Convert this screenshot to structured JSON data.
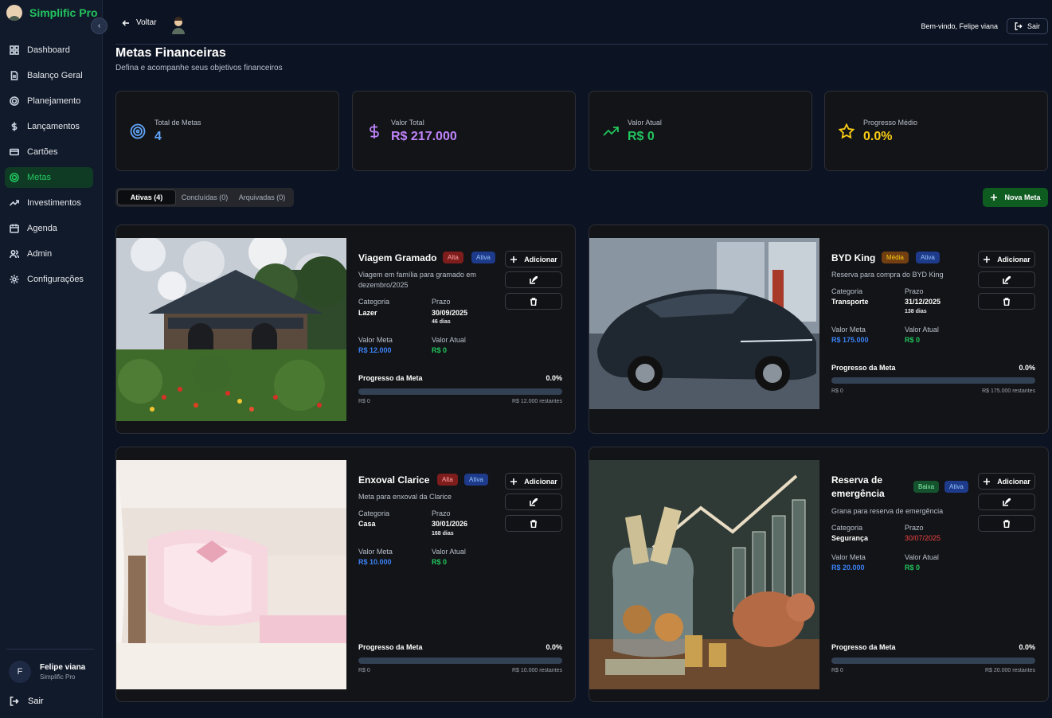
{
  "app": {
    "name": "Simplific Pro"
  },
  "sidebar": {
    "items": [
      {
        "label": "Dashboard",
        "icon": "grid-icon"
      },
      {
        "label": "Balanço Geral",
        "icon": "document-icon"
      },
      {
        "label": "Planejamento",
        "icon": "target-icon"
      },
      {
        "label": "Lançamentos",
        "icon": "dollar-icon"
      },
      {
        "label": "Cartões",
        "icon": "card-icon"
      },
      {
        "label": "Metas",
        "icon": "target-icon",
        "active": true
      },
      {
        "label": "Investimentos",
        "icon": "trend-icon"
      },
      {
        "label": "Agenda",
        "icon": "calendar-icon"
      },
      {
        "label": "Admin",
        "icon": "users-icon"
      },
      {
        "label": "Configurações",
        "icon": "gear-icon"
      }
    ],
    "user": {
      "initial": "F",
      "name": "Felipe viana",
      "plan": "Simplific Pro"
    },
    "logout": "Sair"
  },
  "header": {
    "back": "Voltar",
    "welcome": "Bem-vindo, Felipe viana",
    "logout": "Sair"
  },
  "page": {
    "title": "Metas Financeiras",
    "subtitle": "Defina e acompanhe seus objetivos financeiros"
  },
  "stats": [
    {
      "label": "Total de Metas",
      "value": "4",
      "color": "#60a5fa",
      "icon": "target-icon"
    },
    {
      "label": "Valor Total",
      "value": "R$ 217.000",
      "color": "#c084fc",
      "icon": "dollar-icon"
    },
    {
      "label": "Valor Atual",
      "value": "R$ 0",
      "color": "#22c55e",
      "icon": "trend-up-icon"
    },
    {
      "label": "Progresso Médio",
      "value": "0.0%",
      "color": "#facc15",
      "icon": "star-icon"
    }
  ],
  "tabs": [
    "Ativas (4)",
    "Concluídas (0)",
    "Arquivadas (0)"
  ],
  "new_goal": "Nova Meta",
  "labels": {
    "category": "Categoria",
    "deadline": "Prazo",
    "goal_value": "Valor Meta",
    "current_value": "Valor Atual",
    "progress": "Progresso da Meta",
    "add": "Adicionar"
  },
  "goals": [
    {
      "name": "Viagem Gramado",
      "priority": "Alta",
      "status": "Ativa",
      "description": "Viagem em família para gramado em dezembro/2025",
      "category": "Lazer",
      "deadline": "30/09/2025",
      "days": "46 dias",
      "goal_value": "R$ 12.000",
      "current_value": "R$ 0",
      "progress": 0,
      "progress_text": "0.0%",
      "saved": "R$ 0",
      "remaining": "R$ 12.000 restantes",
      "image": "gramado-portal-photo"
    },
    {
      "name": "BYD King",
      "priority": "Média",
      "status": "Ativa",
      "description": "Reserva para compra do BYD King",
      "category": "Transporte",
      "deadline": "31/12/2025",
      "days": "138 dias",
      "goal_value": "R$ 175.000",
      "current_value": "R$ 0",
      "progress": 0,
      "progress_text": "0.0%",
      "saved": "R$ 0",
      "remaining": "R$ 175.000 restantes",
      "image": "car-photo"
    },
    {
      "name": "Enxoval Clarice",
      "priority": "Alta",
      "status": "Ativa",
      "description": "Meta para enxoval da Clarice",
      "category": "Casa",
      "deadline": "30/01/2026",
      "days": "168 dias",
      "goal_value": "R$ 10.000",
      "current_value": "R$ 0",
      "progress": 0,
      "progress_text": "0.0%",
      "saved": "R$ 0",
      "remaining": "R$ 10.000 restantes",
      "image": "baby-crib-photo"
    },
    {
      "name": "Reserva de emergência",
      "priority": "Baixa",
      "status": "Ativa",
      "description": "Grana para reserva de emergência",
      "category": "Segurança",
      "deadline": "30/07/2025",
      "days": "",
      "goal_value": "R$ 20.000",
      "current_value": "R$ 0",
      "progress": 0,
      "progress_text": "0.0%",
      "saved": "R$ 0",
      "remaining": "R$ 20.000 restantes",
      "image": "piggy-bank-photo"
    }
  ]
}
